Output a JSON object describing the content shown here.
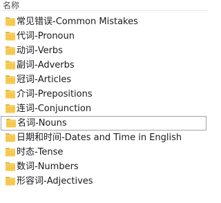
{
  "header": {
    "name_column": "名称"
  },
  "folders": [
    {
      "label": "常见错误-Common Mistakes",
      "selected": false
    },
    {
      "label": "代词-Pronoun",
      "selected": false
    },
    {
      "label": "动词-Verbs",
      "selected": false
    },
    {
      "label": "副词-Adverbs",
      "selected": false
    },
    {
      "label": "冠词-Articles",
      "selected": false
    },
    {
      "label": "介词-Prepositions",
      "selected": false
    },
    {
      "label": "连词-Conjunction",
      "selected": false
    },
    {
      "label": "名词-Nouns",
      "selected": true
    },
    {
      "label": "日期和时间-Dates and Time in English",
      "selected": false
    },
    {
      "label": "时态-Tense",
      "selected": false
    },
    {
      "label": "数词-Numbers",
      "selected": false
    },
    {
      "label": "形容词-Adjectives",
      "selected": false
    }
  ],
  "icons": {
    "folder": "folder-icon"
  },
  "colors": {
    "folder_body": "#f6c94e",
    "folder_tab": "#e8b53a",
    "selection_border": "#9ca3ab"
  }
}
